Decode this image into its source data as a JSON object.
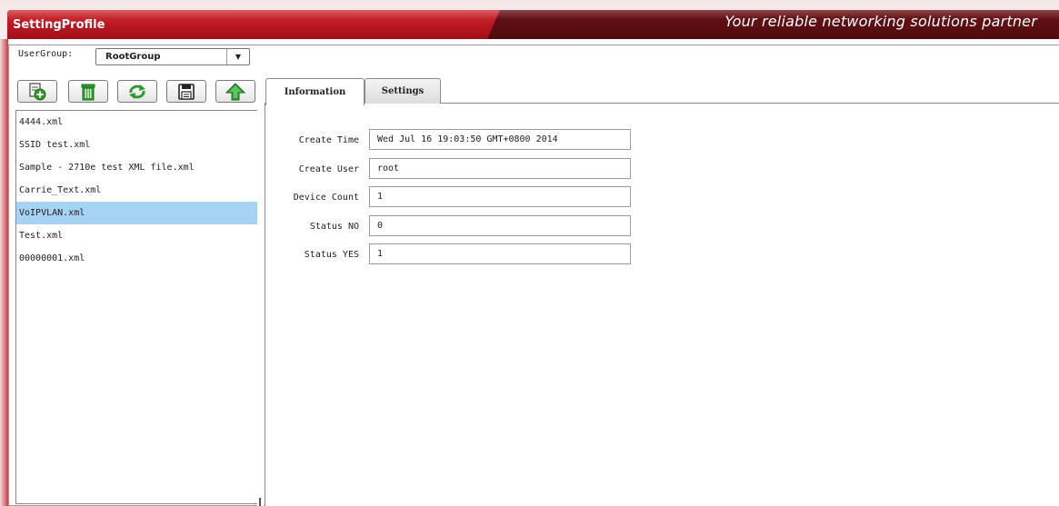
{
  "header": {
    "title": "SettingProfile",
    "tagline": "Your reliable networking solutions partner"
  },
  "usergroup": {
    "label": "UserGroup:",
    "selected": "RootGroup"
  },
  "toolbar": {
    "buttons": [
      {
        "icon": "add-icon",
        "label": ""
      },
      {
        "icon": "trash-icon",
        "label": ""
      },
      {
        "icon": "refresh-icon",
        "label": ""
      },
      {
        "icon": "save-icon",
        "label": ""
      },
      {
        "icon": "upload-icon",
        "label": ""
      }
    ]
  },
  "files": {
    "items": [
      {
        "name": "4444.xml"
      },
      {
        "name": "SSID test.xml"
      },
      {
        "name": "Sample - 2710e test XML file.xml"
      },
      {
        "name": "Carrie_Text.xml"
      },
      {
        "name": "VoIPVLAN.xml"
      },
      {
        "name": "Test.xml"
      },
      {
        "name": "00000001.xml"
      }
    ],
    "selected_index": 4
  },
  "tabs": {
    "items": [
      {
        "label": "Information"
      },
      {
        "label": "Settings"
      }
    ],
    "active": "Information"
  },
  "info": {
    "fields": [
      {
        "label": "Create Time",
        "value": "Wed Jul 16 19:03:50 GMT+0800 2014"
      },
      {
        "label": "Create User",
        "value": "root"
      },
      {
        "label": "Device Count",
        "value": "1"
      },
      {
        "label": "Status NO",
        "value": "0"
      },
      {
        "label": "Status YES",
        "value": "1"
      }
    ]
  },
  "colors": {
    "brand_red": "#b8161f",
    "brand_dark": "#4e0a0e",
    "selection": "#a6d3f4",
    "icon_green": "#2f9a2f"
  }
}
